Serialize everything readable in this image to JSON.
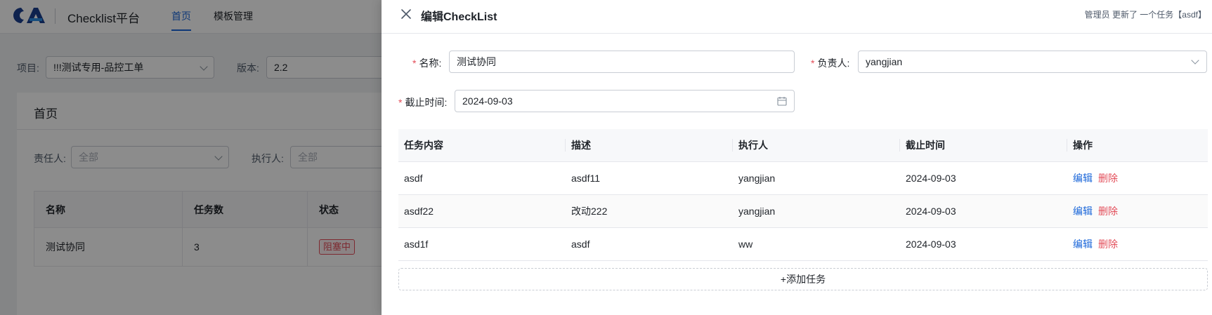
{
  "app": {
    "title": "Checklist平台",
    "nav": [
      "首页",
      "模板管理"
    ]
  },
  "filters": {
    "project_label": "项目:",
    "project_value": "!!!测试专用-品控工单",
    "version_label": "版本:",
    "version_value": "2.2",
    "owner_label": "责任人:",
    "owner_placeholder": "全部",
    "executor_label": "执行人:",
    "executor_placeholder": "全部"
  },
  "home_card": {
    "title": "首页",
    "columns": [
      "名称",
      "任务数",
      "状态"
    ],
    "rows": [
      {
        "name": "测试协同",
        "tasks": "3",
        "status": "阻塞中"
      }
    ]
  },
  "drawer": {
    "title": "编辑CheckList",
    "activity_log": "管理员 更新了 一个任务【asdf】",
    "form": {
      "name_label": "名称:",
      "name_value": "测试协同",
      "owner_label": "负责人:",
      "owner_value": "yangjian",
      "deadline_label": "截止时间:",
      "deadline_value": "2024-09-03"
    },
    "table": {
      "columns": [
        "任务内容",
        "描述",
        "执行人",
        "截止时间",
        "操作"
      ],
      "rows": [
        {
          "content": "asdf",
          "desc": "asdf11",
          "executor": "yangjian",
          "deadline": "2024-09-03"
        },
        {
          "content": "asdf22",
          "desc": "改动222",
          "executor": "yangjian",
          "deadline": "2024-09-03"
        },
        {
          "content": "asd1f",
          "desc": "asdf",
          "executor": "ww",
          "deadline": "2024-09-03"
        }
      ],
      "edit_label": "编辑",
      "delete_label": "删除"
    },
    "add_task_label": "+添加任务"
  },
  "colors": {
    "primary": "#1a66d9",
    "danger": "#e34d59",
    "mask": "rgba(0,0,0,0.45)"
  }
}
